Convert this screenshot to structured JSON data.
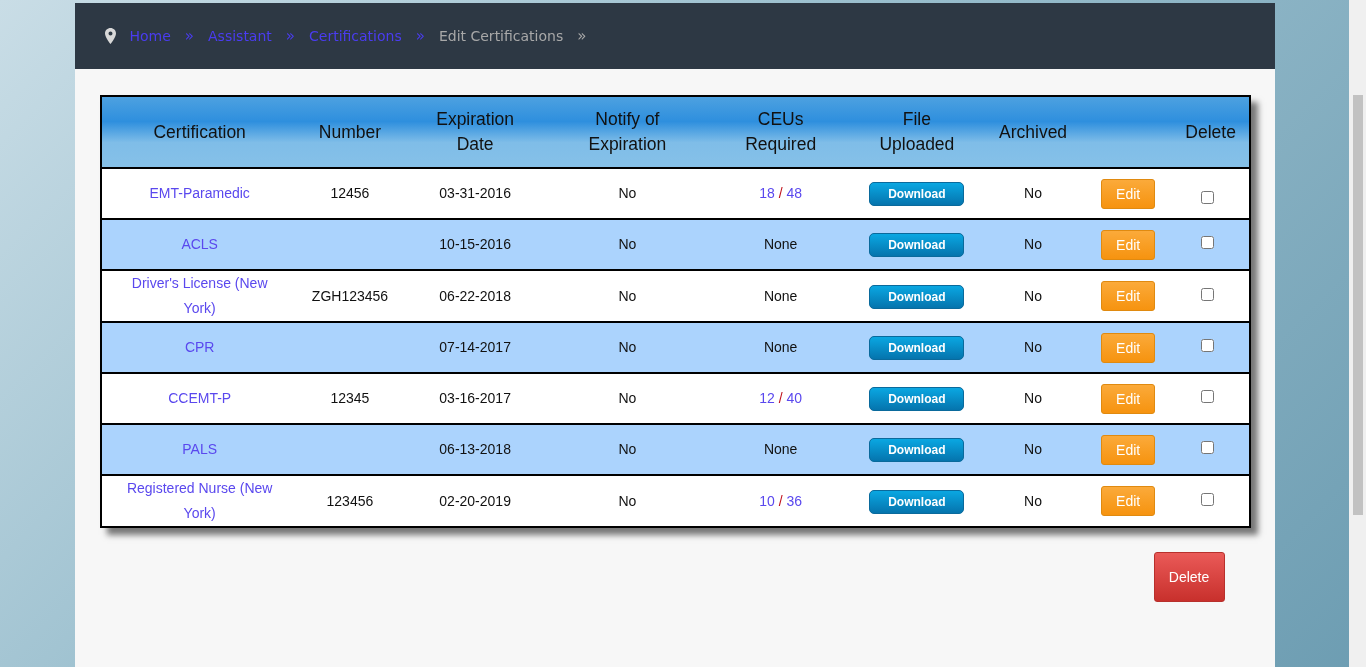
{
  "breadcrumb": [
    {
      "label": "Home",
      "kind": "link"
    },
    {
      "label": "Assistant",
      "kind": "link"
    },
    {
      "label": "Certifications",
      "kind": "link"
    },
    {
      "label": "Edit Certifications",
      "kind": "current"
    }
  ],
  "separator": "»",
  "table": {
    "columns": [
      "Certification",
      "Number",
      "Expiration Date",
      "Notify of Expiration",
      "CEUs Required",
      "File Uploaded",
      "Archived",
      "",
      "Delete"
    ],
    "rows": [
      {
        "certification": "EMT-Paramedic",
        "number": "12456",
        "expiration": "03-31-2016",
        "notify": "No",
        "ceus": {
          "kind": "progress",
          "done": "18",
          "required": "48",
          "slash": "/"
        },
        "file": "Download",
        "archived": "No",
        "edit": "Edit",
        "checked": false
      },
      {
        "certification": "ACLS",
        "number": "",
        "expiration": "10-15-2016",
        "notify": "No",
        "ceus": {
          "kind": "text",
          "text": "None"
        },
        "file": "Download",
        "archived": "No",
        "edit": "Edit",
        "checked": false
      },
      {
        "certification": "Driver's License (New York)",
        "number": "ZGH123456",
        "expiration": "06-22-2018",
        "notify": "No",
        "ceus": {
          "kind": "text",
          "text": "None"
        },
        "file": "Download",
        "archived": "No",
        "edit": "Edit",
        "checked": false
      },
      {
        "certification": "CPR",
        "number": "",
        "expiration": "07-14-2017",
        "notify": "No",
        "ceus": {
          "kind": "text",
          "text": "None"
        },
        "file": "Download",
        "archived": "No",
        "edit": "Edit",
        "checked": false
      },
      {
        "certification": "CCEMT-P",
        "number": "12345",
        "expiration": "03-16-2017",
        "notify": "No",
        "ceus": {
          "kind": "progress",
          "done": "12",
          "required": "40",
          "slash": "/"
        },
        "file": "Download",
        "archived": "No",
        "edit": "Edit",
        "checked": false
      },
      {
        "certification": "PALS",
        "number": "",
        "expiration": "06-13-2018",
        "notify": "No",
        "ceus": {
          "kind": "text",
          "text": "None"
        },
        "file": "Download",
        "archived": "No",
        "edit": "Edit",
        "checked": false
      },
      {
        "certification": "Registered Nurse (New York)",
        "number": "123456",
        "expiration": "02-20-2019",
        "notify": "No",
        "ceus": {
          "kind": "progress",
          "done": "10",
          "required": "36",
          "slash": "/"
        },
        "file": "Download",
        "archived": "No",
        "edit": "Edit",
        "checked": false
      }
    ]
  },
  "delete_button": "Delete"
}
